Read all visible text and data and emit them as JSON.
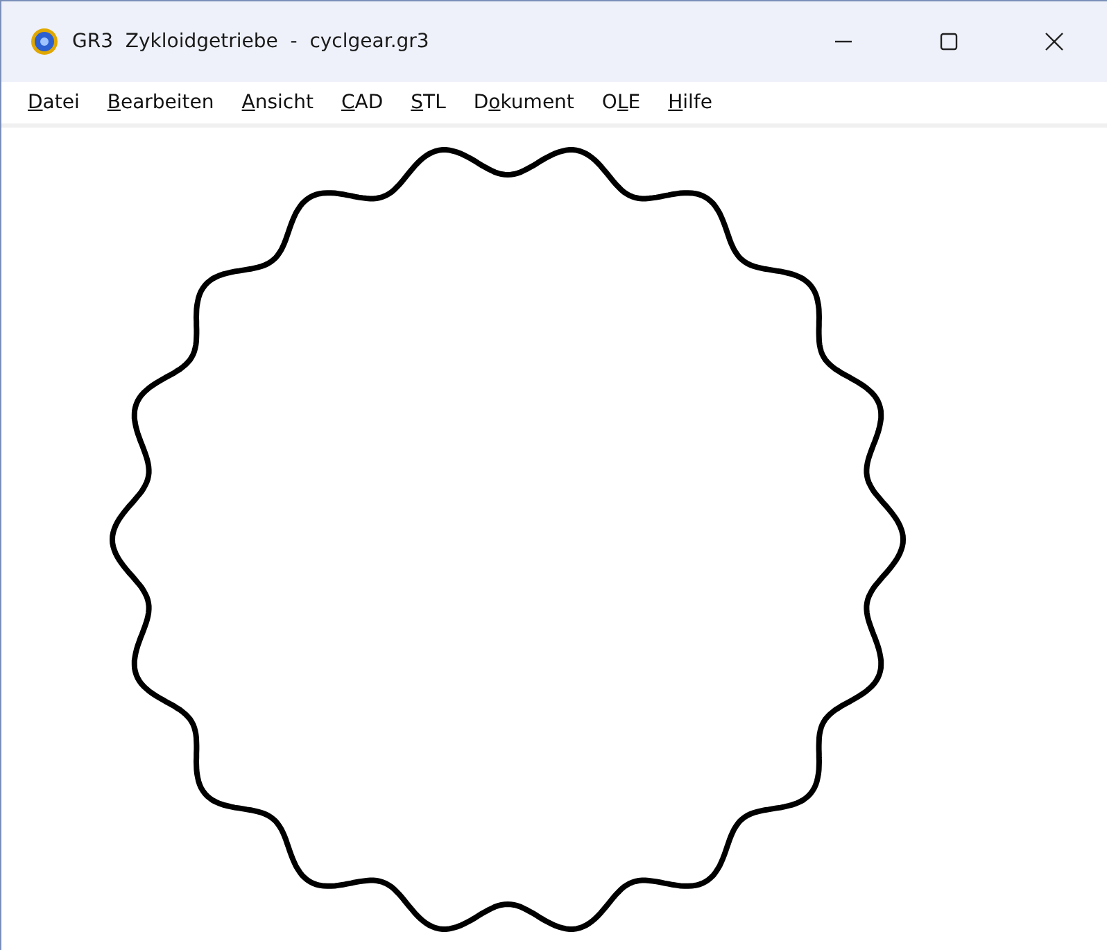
{
  "window": {
    "title": "GR3  Zykloidgetriebe  -  cyclgear.gr3"
  },
  "menu": [
    {
      "label": [
        {
          "text": "D",
          "underlined": true
        },
        {
          "text": "atei",
          "underlined": false
        }
      ]
    },
    {
      "label": [
        {
          "text": "B",
          "underlined": true
        },
        {
          "text": "earbeiten",
          "underlined": false
        }
      ]
    },
    {
      "label": [
        {
          "text": "A",
          "underlined": true
        },
        {
          "text": "nsicht",
          "underlined": false
        }
      ]
    },
    {
      "label": [
        {
          "text": "C",
          "underlined": true
        },
        {
          "text": "AD",
          "underlined": false
        }
      ]
    },
    {
      "label": [
        {
          "text": "S",
          "underlined": true
        },
        {
          "text": "TL",
          "underlined": false
        }
      ]
    },
    {
      "label": [
        {
          "text": "D",
          "underlined": false
        },
        {
          "text": "o",
          "underlined": true
        },
        {
          "text": "kument",
          "underlined": false
        }
      ]
    },
    {
      "label": [
        {
          "text": "O",
          "underlined": false
        },
        {
          "text": "L",
          "underlined": true
        },
        {
          "text": "E",
          "underlined": false
        }
      ]
    },
    {
      "label": [
        {
          "text": "H",
          "underlined": true
        },
        {
          "text": "ilfe",
          "underlined": false
        }
      ]
    }
  ]
}
